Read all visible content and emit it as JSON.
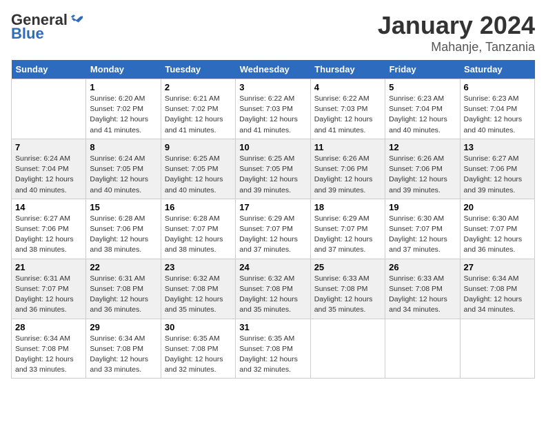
{
  "header": {
    "logo_general": "General",
    "logo_blue": "Blue",
    "month_year": "January 2024",
    "location": "Mahanje, Tanzania"
  },
  "days_of_week": [
    "Sunday",
    "Monday",
    "Tuesday",
    "Wednesday",
    "Thursday",
    "Friday",
    "Saturday"
  ],
  "weeks": [
    [
      {
        "day": "",
        "sunrise": "",
        "sunset": "",
        "daylight": ""
      },
      {
        "day": "1",
        "sunrise": "Sunrise: 6:20 AM",
        "sunset": "Sunset: 7:02 PM",
        "daylight": "Daylight: 12 hours and 41 minutes."
      },
      {
        "day": "2",
        "sunrise": "Sunrise: 6:21 AM",
        "sunset": "Sunset: 7:02 PM",
        "daylight": "Daylight: 12 hours and 41 minutes."
      },
      {
        "day": "3",
        "sunrise": "Sunrise: 6:22 AM",
        "sunset": "Sunset: 7:03 PM",
        "daylight": "Daylight: 12 hours and 41 minutes."
      },
      {
        "day": "4",
        "sunrise": "Sunrise: 6:22 AM",
        "sunset": "Sunset: 7:03 PM",
        "daylight": "Daylight: 12 hours and 41 minutes."
      },
      {
        "day": "5",
        "sunrise": "Sunrise: 6:23 AM",
        "sunset": "Sunset: 7:04 PM",
        "daylight": "Daylight: 12 hours and 40 minutes."
      },
      {
        "day": "6",
        "sunrise": "Sunrise: 6:23 AM",
        "sunset": "Sunset: 7:04 PM",
        "daylight": "Daylight: 12 hours and 40 minutes."
      }
    ],
    [
      {
        "day": "7",
        "sunrise": "Sunrise: 6:24 AM",
        "sunset": "Sunset: 7:04 PM",
        "daylight": "Daylight: 12 hours and 40 minutes."
      },
      {
        "day": "8",
        "sunrise": "Sunrise: 6:24 AM",
        "sunset": "Sunset: 7:05 PM",
        "daylight": "Daylight: 12 hours and 40 minutes."
      },
      {
        "day": "9",
        "sunrise": "Sunrise: 6:25 AM",
        "sunset": "Sunset: 7:05 PM",
        "daylight": "Daylight: 12 hours and 40 minutes."
      },
      {
        "day": "10",
        "sunrise": "Sunrise: 6:25 AM",
        "sunset": "Sunset: 7:05 PM",
        "daylight": "Daylight: 12 hours and 39 minutes."
      },
      {
        "day": "11",
        "sunrise": "Sunrise: 6:26 AM",
        "sunset": "Sunset: 7:06 PM",
        "daylight": "Daylight: 12 hours and 39 minutes."
      },
      {
        "day": "12",
        "sunrise": "Sunrise: 6:26 AM",
        "sunset": "Sunset: 7:06 PM",
        "daylight": "Daylight: 12 hours and 39 minutes."
      },
      {
        "day": "13",
        "sunrise": "Sunrise: 6:27 AM",
        "sunset": "Sunset: 7:06 PM",
        "daylight": "Daylight: 12 hours and 39 minutes."
      }
    ],
    [
      {
        "day": "14",
        "sunrise": "Sunrise: 6:27 AM",
        "sunset": "Sunset: 7:06 PM",
        "daylight": "Daylight: 12 hours and 38 minutes."
      },
      {
        "day": "15",
        "sunrise": "Sunrise: 6:28 AM",
        "sunset": "Sunset: 7:06 PM",
        "daylight": "Daylight: 12 hours and 38 minutes."
      },
      {
        "day": "16",
        "sunrise": "Sunrise: 6:28 AM",
        "sunset": "Sunset: 7:07 PM",
        "daylight": "Daylight: 12 hours and 38 minutes."
      },
      {
        "day": "17",
        "sunrise": "Sunrise: 6:29 AM",
        "sunset": "Sunset: 7:07 PM",
        "daylight": "Daylight: 12 hours and 37 minutes."
      },
      {
        "day": "18",
        "sunrise": "Sunrise: 6:29 AM",
        "sunset": "Sunset: 7:07 PM",
        "daylight": "Daylight: 12 hours and 37 minutes."
      },
      {
        "day": "19",
        "sunrise": "Sunrise: 6:30 AM",
        "sunset": "Sunset: 7:07 PM",
        "daylight": "Daylight: 12 hours and 37 minutes."
      },
      {
        "day": "20",
        "sunrise": "Sunrise: 6:30 AM",
        "sunset": "Sunset: 7:07 PM",
        "daylight": "Daylight: 12 hours and 36 minutes."
      }
    ],
    [
      {
        "day": "21",
        "sunrise": "Sunrise: 6:31 AM",
        "sunset": "Sunset: 7:07 PM",
        "daylight": "Daylight: 12 hours and 36 minutes."
      },
      {
        "day": "22",
        "sunrise": "Sunrise: 6:31 AM",
        "sunset": "Sunset: 7:08 PM",
        "daylight": "Daylight: 12 hours and 36 minutes."
      },
      {
        "day": "23",
        "sunrise": "Sunrise: 6:32 AM",
        "sunset": "Sunset: 7:08 PM",
        "daylight": "Daylight: 12 hours and 35 minutes."
      },
      {
        "day": "24",
        "sunrise": "Sunrise: 6:32 AM",
        "sunset": "Sunset: 7:08 PM",
        "daylight": "Daylight: 12 hours and 35 minutes."
      },
      {
        "day": "25",
        "sunrise": "Sunrise: 6:33 AM",
        "sunset": "Sunset: 7:08 PM",
        "daylight": "Daylight: 12 hours and 35 minutes."
      },
      {
        "day": "26",
        "sunrise": "Sunrise: 6:33 AM",
        "sunset": "Sunset: 7:08 PM",
        "daylight": "Daylight: 12 hours and 34 minutes."
      },
      {
        "day": "27",
        "sunrise": "Sunrise: 6:34 AM",
        "sunset": "Sunset: 7:08 PM",
        "daylight": "Daylight: 12 hours and 34 minutes."
      }
    ],
    [
      {
        "day": "28",
        "sunrise": "Sunrise: 6:34 AM",
        "sunset": "Sunset: 7:08 PM",
        "daylight": "Daylight: 12 hours and 33 minutes."
      },
      {
        "day": "29",
        "sunrise": "Sunrise: 6:34 AM",
        "sunset": "Sunset: 7:08 PM",
        "daylight": "Daylight: 12 hours and 33 minutes."
      },
      {
        "day": "30",
        "sunrise": "Sunrise: 6:35 AM",
        "sunset": "Sunset: 7:08 PM",
        "daylight": "Daylight: 12 hours and 32 minutes."
      },
      {
        "day": "31",
        "sunrise": "Sunrise: 6:35 AM",
        "sunset": "Sunset: 7:08 PM",
        "daylight": "Daylight: 12 hours and 32 minutes."
      },
      {
        "day": "",
        "sunrise": "",
        "sunset": "",
        "daylight": ""
      },
      {
        "day": "",
        "sunrise": "",
        "sunset": "",
        "daylight": ""
      },
      {
        "day": "",
        "sunrise": "",
        "sunset": "",
        "daylight": ""
      }
    ]
  ]
}
